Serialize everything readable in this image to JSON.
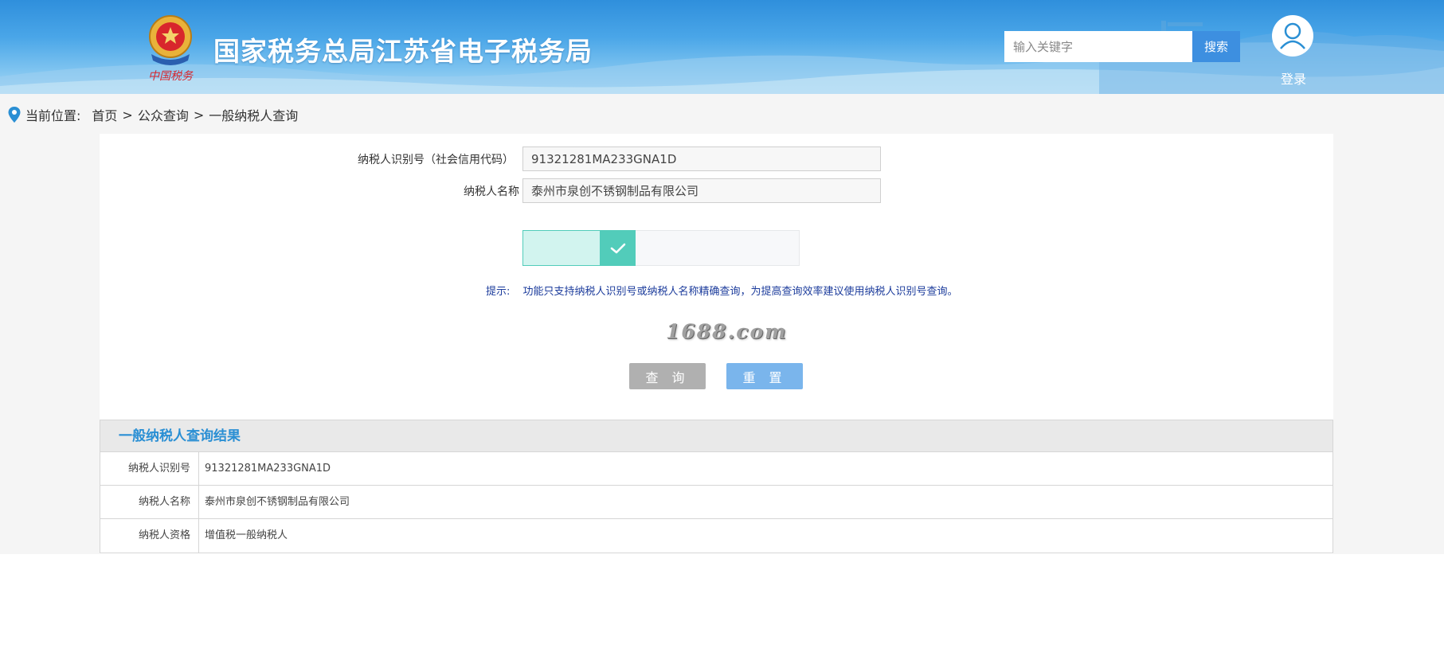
{
  "header": {
    "site_title": "国家税务总局江苏省电子税务局",
    "emblem_caption": "中国税务",
    "search_placeholder": "输入关键字",
    "search_button": "搜索",
    "login": "登录"
  },
  "breadcrumb": {
    "label": "当前位置:",
    "items": [
      "首页",
      "公众查询",
      "一般纳税人查询"
    ],
    "separator": ">"
  },
  "form": {
    "taxpayer_id_label": "纳税人识别号（社会信用代码）",
    "taxpayer_id_value": "91321281MA233GNA1D",
    "taxpayer_name_label": "纳税人名称",
    "taxpayer_name_value": "泰州市泉创不锈钢制品有限公司",
    "tip_label": "提示:",
    "tip_text": "功能只支持纳税人识别号或纳税人名称精确查询，为提高查询效率建议使用纳税人识别号查询。",
    "captcha_text": "1688.com",
    "query_button": "查 询",
    "reset_button": "重 置"
  },
  "result": {
    "title": "一般纳税人查询结果",
    "rows": [
      {
        "label": "纳税人识别号",
        "value": "91321281MA233GNA1D"
      },
      {
        "label": "纳税人名称",
        "value": "泰州市泉创不锈钢制品有限公司"
      },
      {
        "label": "纳税人资格",
        "value": "增值税一般纳税人"
      }
    ]
  },
  "colors": {
    "header_blue": "#2f8fdc",
    "search_button": "#3d8fe0",
    "slider_accent": "#52ccba",
    "tip_text": "#1c3c9c",
    "result_title": "#2a8fd4",
    "reset_button": "#7ab5ec",
    "query_button": "#b0b0b0"
  },
  "icons": {
    "emblem": "tax-emblem-icon",
    "user": "user-icon",
    "location": "location-pin-icon",
    "check": "check-icon"
  }
}
